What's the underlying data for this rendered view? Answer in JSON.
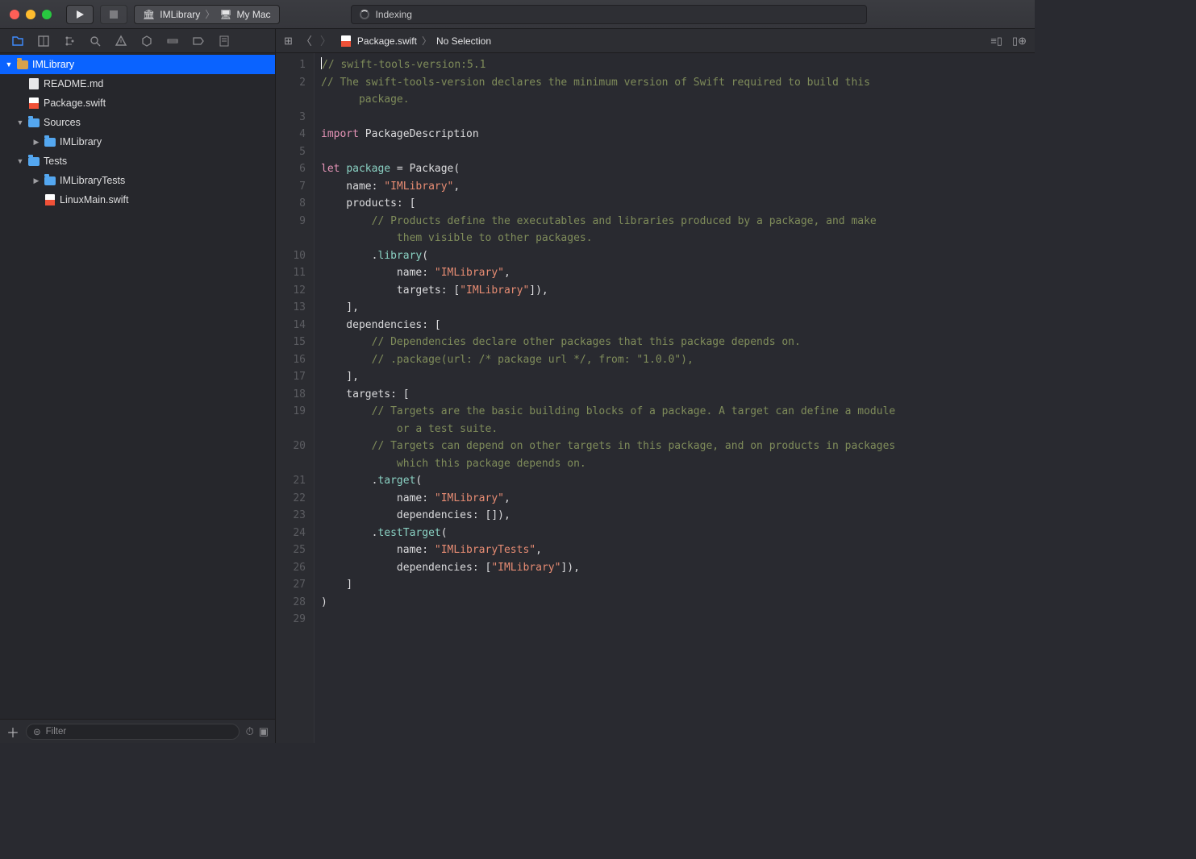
{
  "titlebar": {
    "scheme_project": "IMLibrary",
    "scheme_device": "My Mac",
    "activity_text": "Indexing"
  },
  "navigator": {
    "filter_placeholder": "Filter",
    "tree": {
      "root": "IMLibrary",
      "items": [
        {
          "name": "README.md"
        },
        {
          "name": "Package.swift"
        }
      ],
      "sources_label": "Sources",
      "sources_children": [
        {
          "name": "IMLibrary"
        }
      ],
      "tests_label": "Tests",
      "tests_children": [
        {
          "name": "IMLibraryTests"
        },
        {
          "name": "LinuxMain.swift"
        }
      ]
    }
  },
  "jumpbar": {
    "file": "Package.swift",
    "selection": "No Selection"
  },
  "code": {
    "lines": [
      [
        {
          "t": "comment",
          "v": "// swift-tools-version:5.1"
        }
      ],
      [
        {
          "t": "comment",
          "v": "// The swift-tools-version declares the minimum version of Swift required to build this"
        }
      ],
      [
        {
          "t": "comment",
          "v": "      package."
        }
      ],
      [],
      [
        {
          "t": "key",
          "v": "import"
        },
        {
          "t": "plain",
          "v": " PackageDescription"
        }
      ],
      [],
      [
        {
          "t": "key",
          "v": "let"
        },
        {
          "t": "plain",
          "v": " "
        },
        {
          "t": "ident",
          "v": "package"
        },
        {
          "t": "plain",
          "v": " = Package("
        }
      ],
      [
        {
          "t": "plain",
          "v": "    name: "
        },
        {
          "t": "str",
          "v": "\"IMLibrary\""
        },
        {
          "t": "plain",
          "v": ","
        }
      ],
      [
        {
          "t": "plain",
          "v": "    products: ["
        }
      ],
      [
        {
          "t": "plain",
          "v": "        "
        },
        {
          "t": "comment",
          "v": "// Products define the executables and libraries produced by a package, and make"
        }
      ],
      [
        {
          "t": "comment",
          "v": "            them visible to other packages."
        }
      ],
      [
        {
          "t": "plain",
          "v": "        ."
        },
        {
          "t": "func",
          "v": "library"
        },
        {
          "t": "plain",
          "v": "("
        }
      ],
      [
        {
          "t": "plain",
          "v": "            name: "
        },
        {
          "t": "str",
          "v": "\"IMLibrary\""
        },
        {
          "t": "plain",
          "v": ","
        }
      ],
      [
        {
          "t": "plain",
          "v": "            targets: ["
        },
        {
          "t": "str",
          "v": "\"IMLibrary\""
        },
        {
          "t": "plain",
          "v": "]),"
        }
      ],
      [
        {
          "t": "plain",
          "v": "    ],"
        }
      ],
      [
        {
          "t": "plain",
          "v": "    dependencies: ["
        }
      ],
      [
        {
          "t": "plain",
          "v": "        "
        },
        {
          "t": "comment",
          "v": "// Dependencies declare other packages that this package depends on."
        }
      ],
      [
        {
          "t": "plain",
          "v": "        "
        },
        {
          "t": "comment",
          "v": "// .package(url: /* package url */, from: \"1.0.0\"),"
        }
      ],
      [
        {
          "t": "plain",
          "v": "    ],"
        }
      ],
      [
        {
          "t": "plain",
          "v": "    targets: ["
        }
      ],
      [
        {
          "t": "plain",
          "v": "        "
        },
        {
          "t": "comment",
          "v": "// Targets are the basic building blocks of a package. A target can define a module"
        }
      ],
      [
        {
          "t": "comment",
          "v": "            or a test suite."
        }
      ],
      [
        {
          "t": "plain",
          "v": "        "
        },
        {
          "t": "comment",
          "v": "// Targets can depend on other targets in this package, and on products in packages"
        }
      ],
      [
        {
          "t": "comment",
          "v": "            which this package depends on."
        }
      ],
      [
        {
          "t": "plain",
          "v": "        ."
        },
        {
          "t": "func",
          "v": "target"
        },
        {
          "t": "plain",
          "v": "("
        }
      ],
      [
        {
          "t": "plain",
          "v": "            name: "
        },
        {
          "t": "str",
          "v": "\"IMLibrary\""
        },
        {
          "t": "plain",
          "v": ","
        }
      ],
      [
        {
          "t": "plain",
          "v": "            dependencies: []),"
        }
      ],
      [
        {
          "t": "plain",
          "v": "        ."
        },
        {
          "t": "func",
          "v": "testTarget"
        },
        {
          "t": "plain",
          "v": "("
        }
      ],
      [
        {
          "t": "plain",
          "v": "            name: "
        },
        {
          "t": "str",
          "v": "\"IMLibraryTests\""
        },
        {
          "t": "plain",
          "v": ","
        }
      ],
      [
        {
          "t": "plain",
          "v": "            dependencies: ["
        },
        {
          "t": "str",
          "v": "\"IMLibrary\""
        },
        {
          "t": "plain",
          "v": "]),"
        }
      ],
      [
        {
          "t": "plain",
          "v": "    ]"
        }
      ],
      [
        {
          "t": "plain",
          "v": ")"
        }
      ],
      []
    ],
    "displayed_lines": [
      1,
      2,
      "",
      3,
      4,
      5,
      6,
      7,
      8,
      9,
      "",
      10,
      11,
      12,
      13,
      14,
      15,
      16,
      17,
      18,
      19,
      "",
      20,
      "",
      21,
      22,
      23,
      24,
      25,
      26,
      27,
      28,
      29
    ]
  }
}
